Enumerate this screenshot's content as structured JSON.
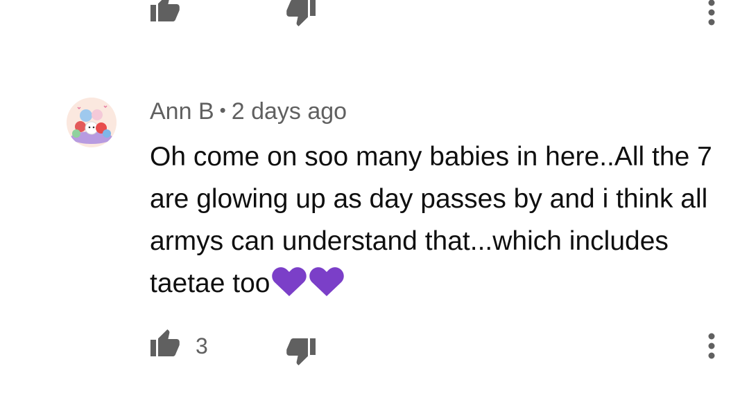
{
  "previous_comment": {
    "like_icon": "thumbs-up-icon",
    "dislike_icon": "thumbs-down-icon",
    "menu_icon": "more-vert-icon"
  },
  "comment": {
    "author": "Ann B",
    "separator": "•",
    "time": "2 days ago",
    "text": "Oh come on soo many babies in here..All the 7 are glowing up as day passes by and i think all armys can understand that...which includes taetae too",
    "emoji": [
      "purple-heart",
      "purple-heart"
    ],
    "like_count": "3",
    "avatar_icon": "bt21-characters-avatar",
    "heart_color": "#7b3fc8"
  }
}
